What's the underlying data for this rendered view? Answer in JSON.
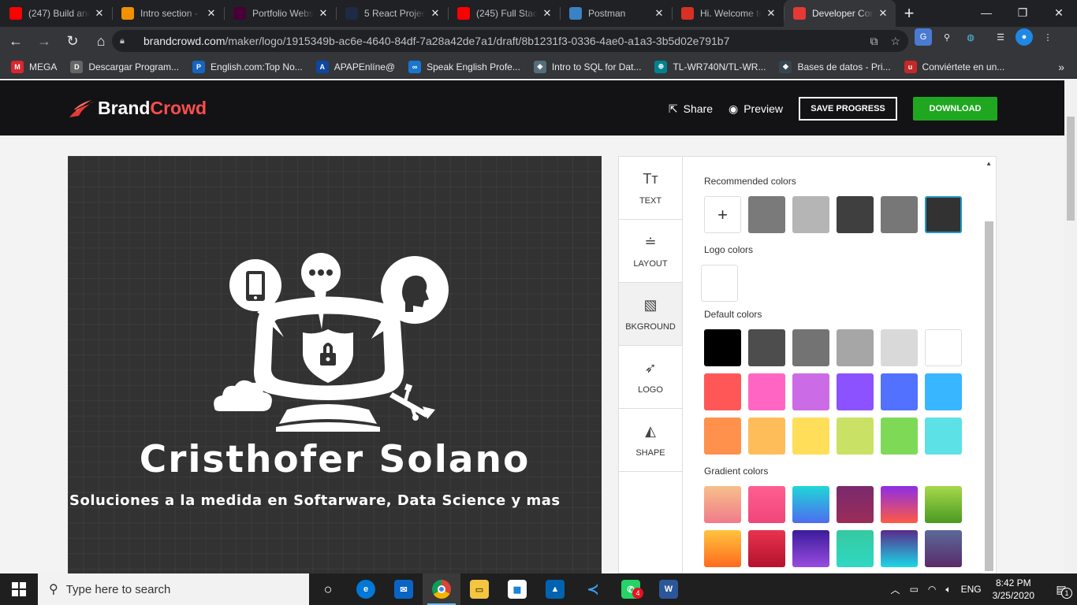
{
  "browser": {
    "tabs": [
      {
        "title": "(247) Build and",
        "icon": "youtube-icon",
        "color": "#ff0000"
      },
      {
        "title": "Intro section -",
        "icon": "chart-icon",
        "color": "#f29100"
      },
      {
        "title": "Portfolio Webs",
        "icon": "adobe-xd-icon",
        "color": "#470137"
      },
      {
        "title": "5 React Project",
        "icon": "react-icon",
        "color": "#1f2a44"
      },
      {
        "title": "(245) Full Stack",
        "icon": "youtube-icon",
        "color": "#ff0000"
      },
      {
        "title": "Postman",
        "icon": "globe-icon",
        "color": "#3b82c4"
      },
      {
        "title": "Hi. Welcome to",
        "icon": "gmail-icon",
        "color": "#d93025"
      },
      {
        "title": "Developer Con",
        "icon": "brandcrowd-icon",
        "color": "#e53935",
        "active": true
      }
    ],
    "url_domain": "brandcrowd.com",
    "url_path": "/maker/logo/1915349b-ac6e-4640-84df-7a28a42de7a1/draft/8b1231f3-0336-4ae0-a1a3-3b5d02e791b7",
    "bookmarks": [
      {
        "label": "MEGA",
        "color": "#d9272e",
        "glyph": "M"
      },
      {
        "label": "Descargar Program...",
        "color": "#666",
        "glyph": "D"
      },
      {
        "label": "English.com:Top No...",
        "color": "#1565c0",
        "glyph": "P"
      },
      {
        "label": "APAPEnlíne@",
        "color": "#0d47a1",
        "glyph": "A"
      },
      {
        "label": "Speak English Profe...",
        "color": "#1976d2",
        "glyph": "∞"
      },
      {
        "label": "Intro to SQL for Dat...",
        "color": "#546e7a",
        "glyph": "◈"
      },
      {
        "label": "TL-WR740N/TL-WR...",
        "color": "#00838f",
        "glyph": "⊕"
      },
      {
        "label": "Bases de datos - Pri...",
        "color": "#37474f",
        "glyph": "◆"
      },
      {
        "label": "Conviértete en un...",
        "color": "#c62828",
        "glyph": "u"
      }
    ]
  },
  "header": {
    "brand_word1": "Brand",
    "brand_word2": "Crowd",
    "share_label": "Share",
    "preview_label": "Preview",
    "save_label": "SAVE PROGRESS",
    "download_label": "DOWNLOAD"
  },
  "canvas": {
    "name": "Cristhofer Solano",
    "tagline": "Soluciones  a la medida en Softarware, Data Science y mas",
    "background_color": "#323232"
  },
  "panel": {
    "tabs": [
      {
        "label": "TEXT",
        "icon": "text-icon"
      },
      {
        "label": "LAYOUT",
        "icon": "layout-icon"
      },
      {
        "label": "BKGROUND",
        "icon": "background-icon",
        "active": true
      },
      {
        "label": "LOGO",
        "icon": "logo-icon"
      },
      {
        "label": "SHAPE",
        "icon": "shape-icon"
      }
    ],
    "recommended_title": "Recommended colors",
    "recommended": [
      "#7a7a7a",
      "#b5b5b5",
      "#3f3f3f",
      "#777777",
      "#323232"
    ],
    "logo_title": "Logo colors",
    "logo_colors": [
      "#ffffff"
    ],
    "default_title": "Default colors",
    "default_colors": [
      [
        "#000000",
        "#4d4d4d",
        "#737373",
        "#a6a6a6",
        "#d9d9d9",
        "#ffffff"
      ],
      [
        "#ff5757",
        "#ff66c4",
        "#cb6ce6",
        "#8c52ff",
        "#5271ff",
        "#38b6ff"
      ],
      [
        "#ff914d",
        "#ffbd59",
        "#ffde59",
        "#c9e265",
        "#7ed957",
        "#5ce1e6"
      ]
    ],
    "gradient_title": "Gradient colors",
    "gradients": [
      [
        "linear-gradient(#f7c08a,#f07b8b)",
        "linear-gradient(#ff5f91,#f0457a)",
        "linear-gradient(#1fd7d7,#4f6bf0)",
        "linear-gradient(#7a2a6e,#9b2c58)",
        "linear-gradient(#8c2ee6,#ff5a44)",
        "linear-gradient(#a6d94a,#4a9a22)"
      ],
      [
        "linear-gradient(#ffc43d,#ff6a1f)",
        "linear-gradient(#e8334f,#b3122d)",
        "linear-gradient(#3a1c9a,#9a4ce0)",
        "linear-gradient(#35c9a0,#2fd9c3)",
        "linear-gradient(#5a2a8a,#1bd8e8)",
        "linear-gradient(#5a6a9a,#5a2a6a)"
      ]
    ]
  },
  "taskbar": {
    "search_placeholder": "Type here to search",
    "lang": "ENG",
    "time": "8:42 PM",
    "date": "3/25/2020",
    "whatsapp_badge": "4",
    "notif_badge": "1"
  }
}
